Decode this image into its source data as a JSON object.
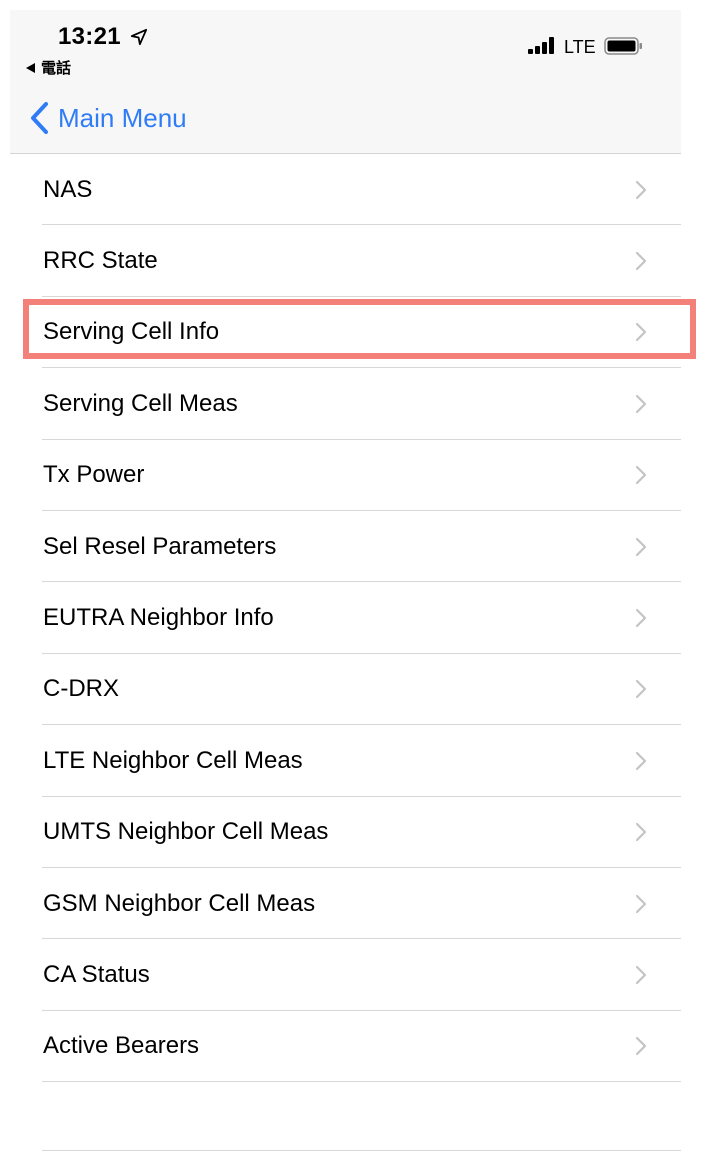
{
  "status_bar": {
    "time": "13:21",
    "back_app": "電話",
    "network": "LTE",
    "icons": [
      "location-arrow-icon",
      "signal-bars-icon",
      "battery-icon"
    ]
  },
  "nav": {
    "back_label": "Main Menu",
    "back_icon": "chevron-left-icon",
    "accent_color": "#2f7cf6"
  },
  "menu": {
    "items": [
      {
        "label": "NAS"
      },
      {
        "label": "RRC State"
      },
      {
        "label": "Serving Cell Info"
      },
      {
        "label": "Serving Cell Meas"
      },
      {
        "label": "Tx Power"
      },
      {
        "label": "Sel Resel Parameters"
      },
      {
        "label": "EUTRA Neighbor Info"
      },
      {
        "label": "C-DRX"
      },
      {
        "label": "LTE Neighbor Cell Meas"
      },
      {
        "label": "UMTS Neighbor Cell Meas"
      },
      {
        "label": "GSM Neighbor Cell Meas"
      },
      {
        "label": "CA Status"
      },
      {
        "label": "Active Bearers"
      }
    ],
    "row_icon": "chevron-right-icon"
  },
  "highlight": {
    "target": "Serving Cell Info",
    "color": "#f4807a"
  }
}
